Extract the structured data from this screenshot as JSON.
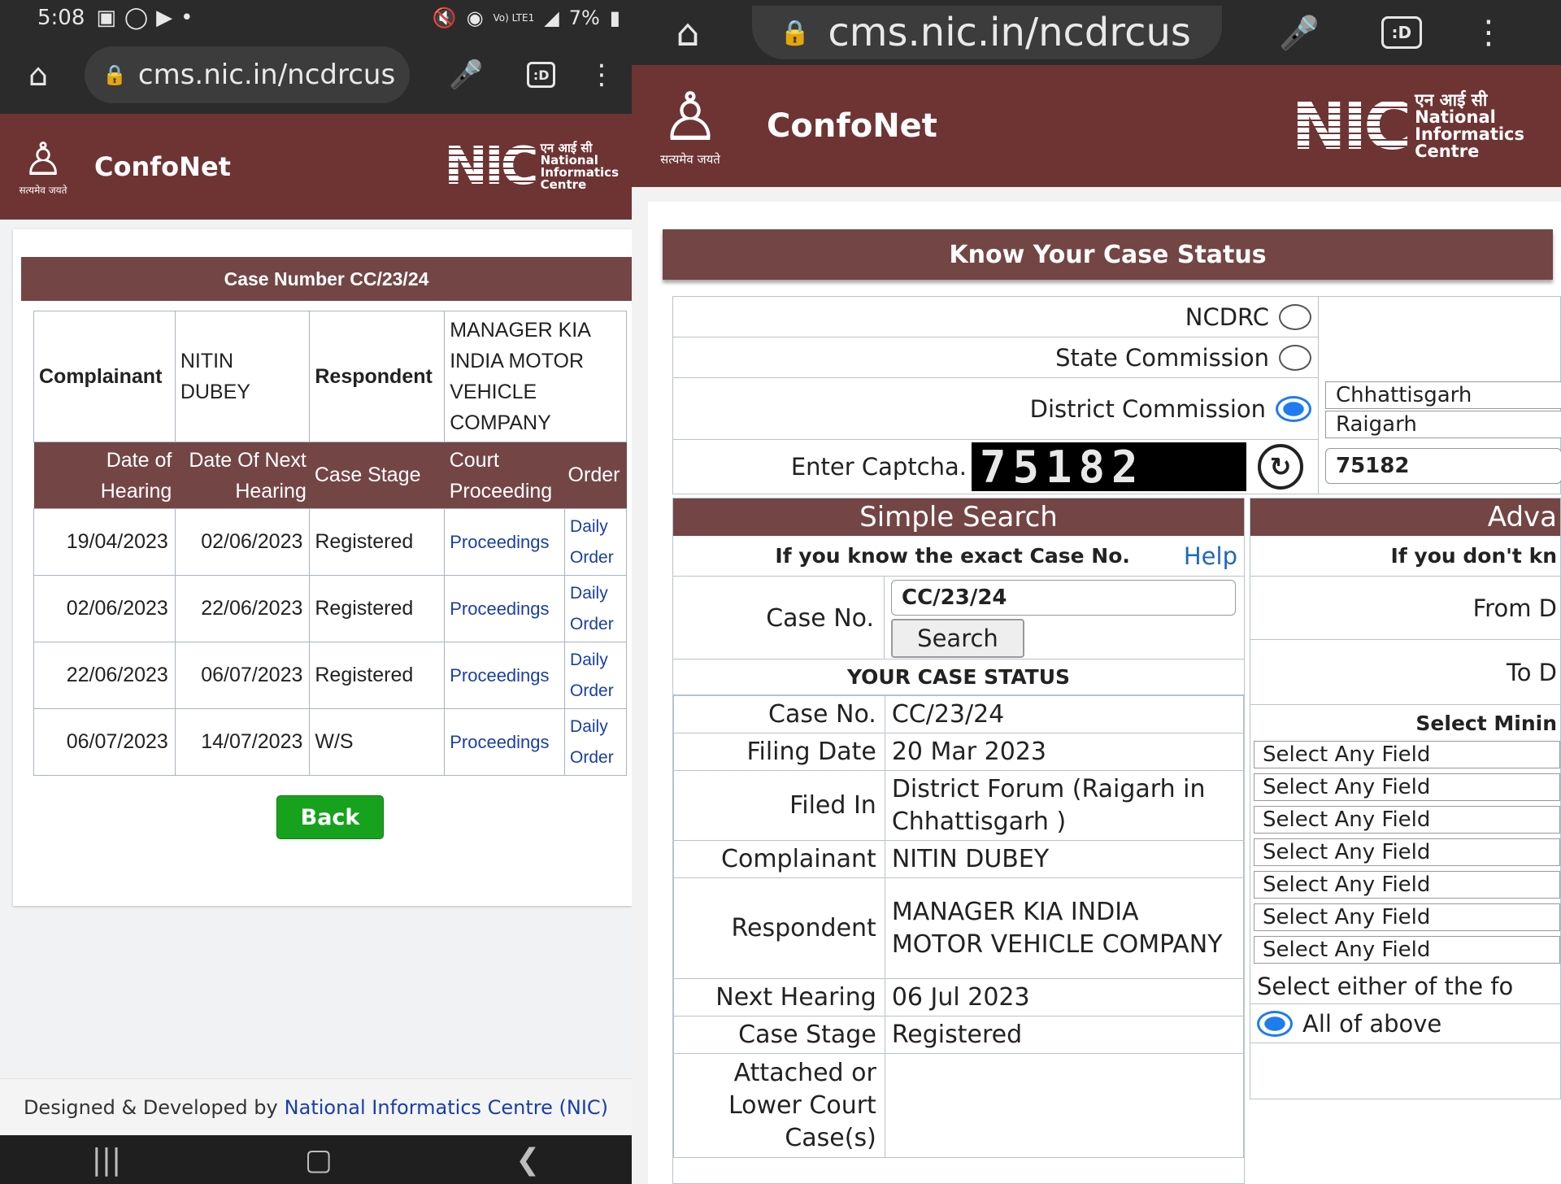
{
  "left": {
    "status": {
      "time": "5:08",
      "battery": "7%",
      "lte": "Vo) LTE1"
    },
    "url": "cms.nic.in/ncdrcus",
    "brand": {
      "name": "ConfoNet",
      "emblem_motto": "सत्यमेव जयते",
      "nic_hindi": "एन आई सी",
      "nic_lines": [
        "National",
        "Informatics",
        "Centre"
      ]
    },
    "case_title": "Case Number CC/23/24",
    "parties": {
      "complainant_label": "Complainant",
      "complainant": "NITIN DUBEY",
      "respondent_label": "Respondent",
      "respondent": "MANAGER KIA INDIA MOTOR VEHICLE COMPANY"
    },
    "columns": [
      "Date of Hearing",
      "Date Of Next Hearing",
      "Case Stage",
      "Court Proceeding",
      "Order"
    ],
    "rows": [
      {
        "date": "19/04/2023",
        "next": "02/06/2023",
        "stage": "Registered",
        "proceeding": "Proceedings",
        "order": "Daily Order"
      },
      {
        "date": "02/06/2023",
        "next": "22/06/2023",
        "stage": "Registered",
        "proceeding": "Proceedings",
        "order": "Daily Order"
      },
      {
        "date": "22/06/2023",
        "next": "06/07/2023",
        "stage": "Registered",
        "proceeding": "Proceedings",
        "order": "Daily Order"
      },
      {
        "date": "06/07/2023",
        "next": "14/07/2023",
        "stage": "W/S",
        "proceeding": "Proceedings",
        "order": "Daily Order"
      }
    ],
    "back_label": "Back",
    "footer_prefix": "Designed & Developed by",
    "footer_link": "National Informatics Centre (NIC)"
  },
  "right": {
    "url": "cms.nic.in/ncdrcus",
    "brand": {
      "name": "ConfoNet",
      "emblem_motto": "सत्यमेव जयते",
      "nic_hindi": "एन आई सी",
      "nic_lines": [
        "National",
        "Informatics",
        "Centre"
      ]
    },
    "page_title": "Know Your Case Status",
    "commission": {
      "ncdrc": "NCDRC",
      "state": "State Commission",
      "district": "District Commission",
      "state_value": "Chhattisgarh",
      "district_value": "Raigarh"
    },
    "captcha": {
      "label": "Enter Captcha.",
      "image_text": "75182",
      "value": "75182"
    },
    "simple": {
      "title": "Simple Search",
      "hint": "If you know the exact Case No.",
      "help": "Help",
      "case_label": "Case No.",
      "case_value": "CC/23/24",
      "search_label": "Search"
    },
    "status": {
      "title": "YOUR CASE STATUS",
      "rows": [
        {
          "label": "Case No.",
          "value": "CC/23/24"
        },
        {
          "label": "Filing Date",
          "value": "20 Mar 2023"
        },
        {
          "label": "Filed In",
          "value": "District Forum (Raigarh in Chhattisgarh )"
        },
        {
          "label": "Complainant",
          "value": "NITIN DUBEY"
        },
        {
          "label": "Respondent",
          "value": "MANAGER KIA INDIA MOTOR VEHICLE COMPANY"
        },
        {
          "label": "Next Hearing",
          "value": "06 Jul 2023"
        },
        {
          "label": "Case Stage",
          "value": "Registered"
        },
        {
          "label": "Attached or Lower Court Case(s)",
          "value": ""
        }
      ]
    },
    "advanced": {
      "title": "Adva",
      "hint": "If you don't kn",
      "from": "From D",
      "to": "To D",
      "select_min": "Select Minin",
      "fields": [
        "Select Any Field",
        "Select Any Field",
        "Select Any Field",
        "Select Any Field",
        "Select Any Field",
        "Select Any Field",
        "Select Any Field"
      ],
      "either": "Select either of the fo",
      "all": "All of above"
    }
  },
  "colors": {
    "maroon": "#6e3434",
    "header_cell": "#744545",
    "green": "#17a21e",
    "link": "#1a3ea8",
    "radio": "#1e7bf0"
  }
}
